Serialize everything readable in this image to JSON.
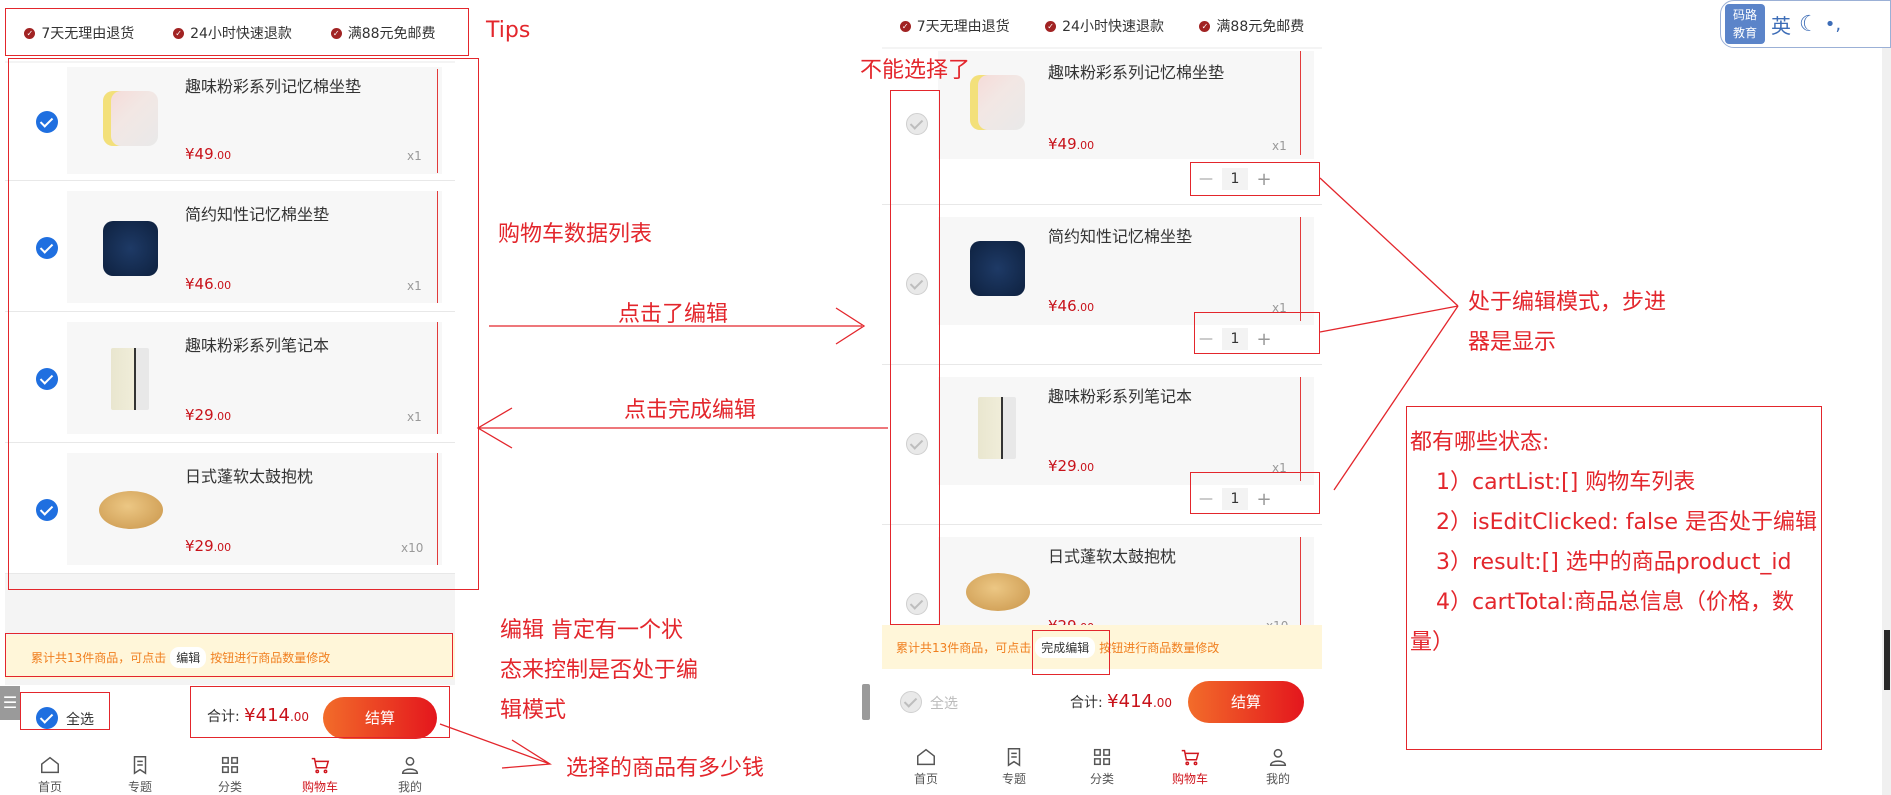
{
  "tips": [
    "7天无理由退货",
    "24小时快速退款",
    "满88元免邮费"
  ],
  "products": [
    {
      "name": "趣味粉彩系列记忆棉坐垫",
      "price_int": "¥49",
      "price_dec": ".00",
      "qty": "x1"
    },
    {
      "name": "简约知性记忆棉坐垫",
      "price_int": "¥46",
      "price_dec": ".00",
      "qty": "x1"
    },
    {
      "name": "趣味粉彩系列笔记本",
      "price_int": "¥29",
      "price_dec": ".00",
      "qty": "x1"
    },
    {
      "name": "日式蓬软太鼓抱枕",
      "price_int": "¥29",
      "price_dec": ".00",
      "qty": "x10"
    }
  ],
  "stepper": {
    "minus": "—",
    "value": "1",
    "plus": "+"
  },
  "notice": {
    "prefix": "累计共13件商品，可点击",
    "edit_label": "编辑",
    "done_label": "完成编辑",
    "suffix": "按钮进行商品数量修改"
  },
  "footer": {
    "select_all": "全选",
    "total_label": "合计:",
    "total_int": "¥414",
    "total_dec": ".00",
    "pay_label": "结算"
  },
  "tabs": [
    {
      "label": "首页",
      "icon": "home-icon"
    },
    {
      "label": "专题",
      "icon": "topic-icon"
    },
    {
      "label": "分类",
      "icon": "category-icon"
    },
    {
      "label": "购物车",
      "icon": "cart-icon"
    },
    {
      "label": "我的",
      "icon": "user-icon"
    }
  ],
  "active_tab": "购物车",
  "annotations": {
    "tips": "Tips",
    "cart_list": "购物车数据列表",
    "clicked_edit": "点击了编辑",
    "clicked_done": "点击完成编辑",
    "cannot_select": "不能选择了",
    "edit_state_1": "编辑  肯定有一个状",
    "edit_state_2": "态来控制是否处于编",
    "edit_state_3": "辑模式",
    "total_money": "选择的商品有多少钱",
    "stepper_mode_1": "处于编辑模式，步进",
    "stepper_mode_2": "器是显示",
    "states_title": "都有哪些状态:",
    "state_1": "1）cartList:[]     购物车列表",
    "state_2": "2）isEditClicked: false  是否处于编辑",
    "state_3": "3）result:[]  选中的商品product_id",
    "state_4": "4）cartTotal:商品总信息（价格，数",
    "state_4b": "量）"
  },
  "ime": {
    "logo_line1": "码路",
    "logo_line2": "教育",
    "lang": "英",
    "moon": "☾",
    "dots": "•,"
  },
  "colors": {
    "accent_red": "#e3262c",
    "price_red": "#c8121a",
    "check_blue": "#1f6fe0",
    "notice_bg": "#fff6d9",
    "notice_text": "#f07f1f"
  }
}
